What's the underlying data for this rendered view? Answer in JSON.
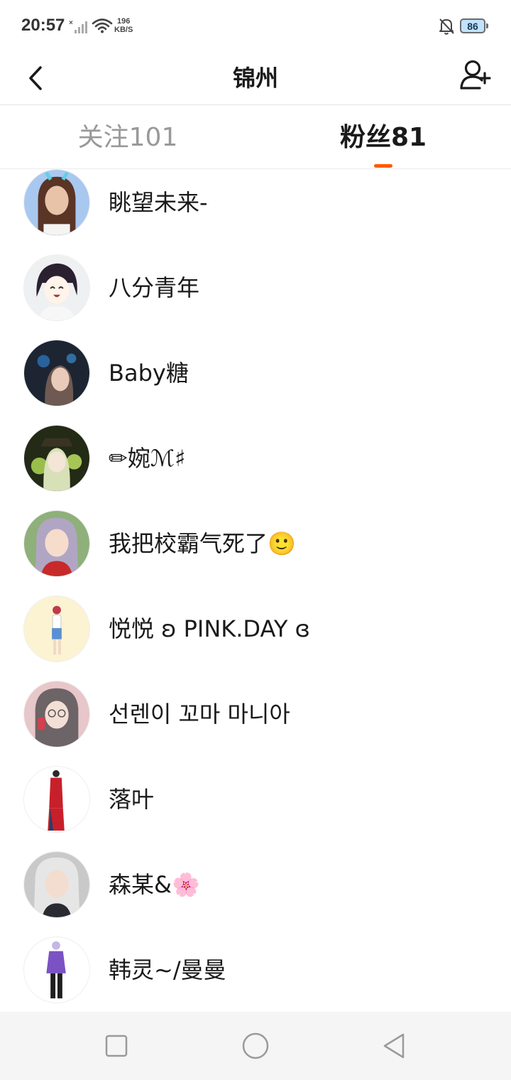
{
  "status_bar": {
    "time": "20:57",
    "net_speed_value": "196",
    "net_speed_unit": "KB/S",
    "battery": "86",
    "icons": [
      "signal-icon",
      "wifi-icon",
      "bell-off-icon",
      "battery-icon"
    ]
  },
  "header": {
    "title": "锦州",
    "back_icon": "chevron-left-icon",
    "add_user_icon": "add-user-icon"
  },
  "tabs": [
    {
      "label": "关注101",
      "active": false
    },
    {
      "label": "粉丝81",
      "active": true
    }
  ],
  "colors": {
    "accent": "#ff5b00",
    "inactive_tab": "#999999",
    "text": "#1a1a1a",
    "nav_bar": "#f5f5f5"
  },
  "followers": [
    {
      "name": "眺望未来-"
    },
    {
      "name": "八分青年"
    },
    {
      "name": "Baby糖"
    },
    {
      "name": "✏婉ℳ♯"
    },
    {
      "name": "我把校霸气死了🙂"
    },
    {
      "name": "悦悦  ʚ PINK.DAY ɞ"
    },
    {
      "name": "선렌이 꼬마 마니아"
    },
    {
      "name": "落叶"
    },
    {
      "name": "森某&🌸"
    },
    {
      "name": "韩灵~/曼曼"
    }
  ],
  "nav_bar": {
    "icons": [
      "recents-square-icon",
      "home-circle-icon",
      "back-triangle-icon"
    ]
  }
}
